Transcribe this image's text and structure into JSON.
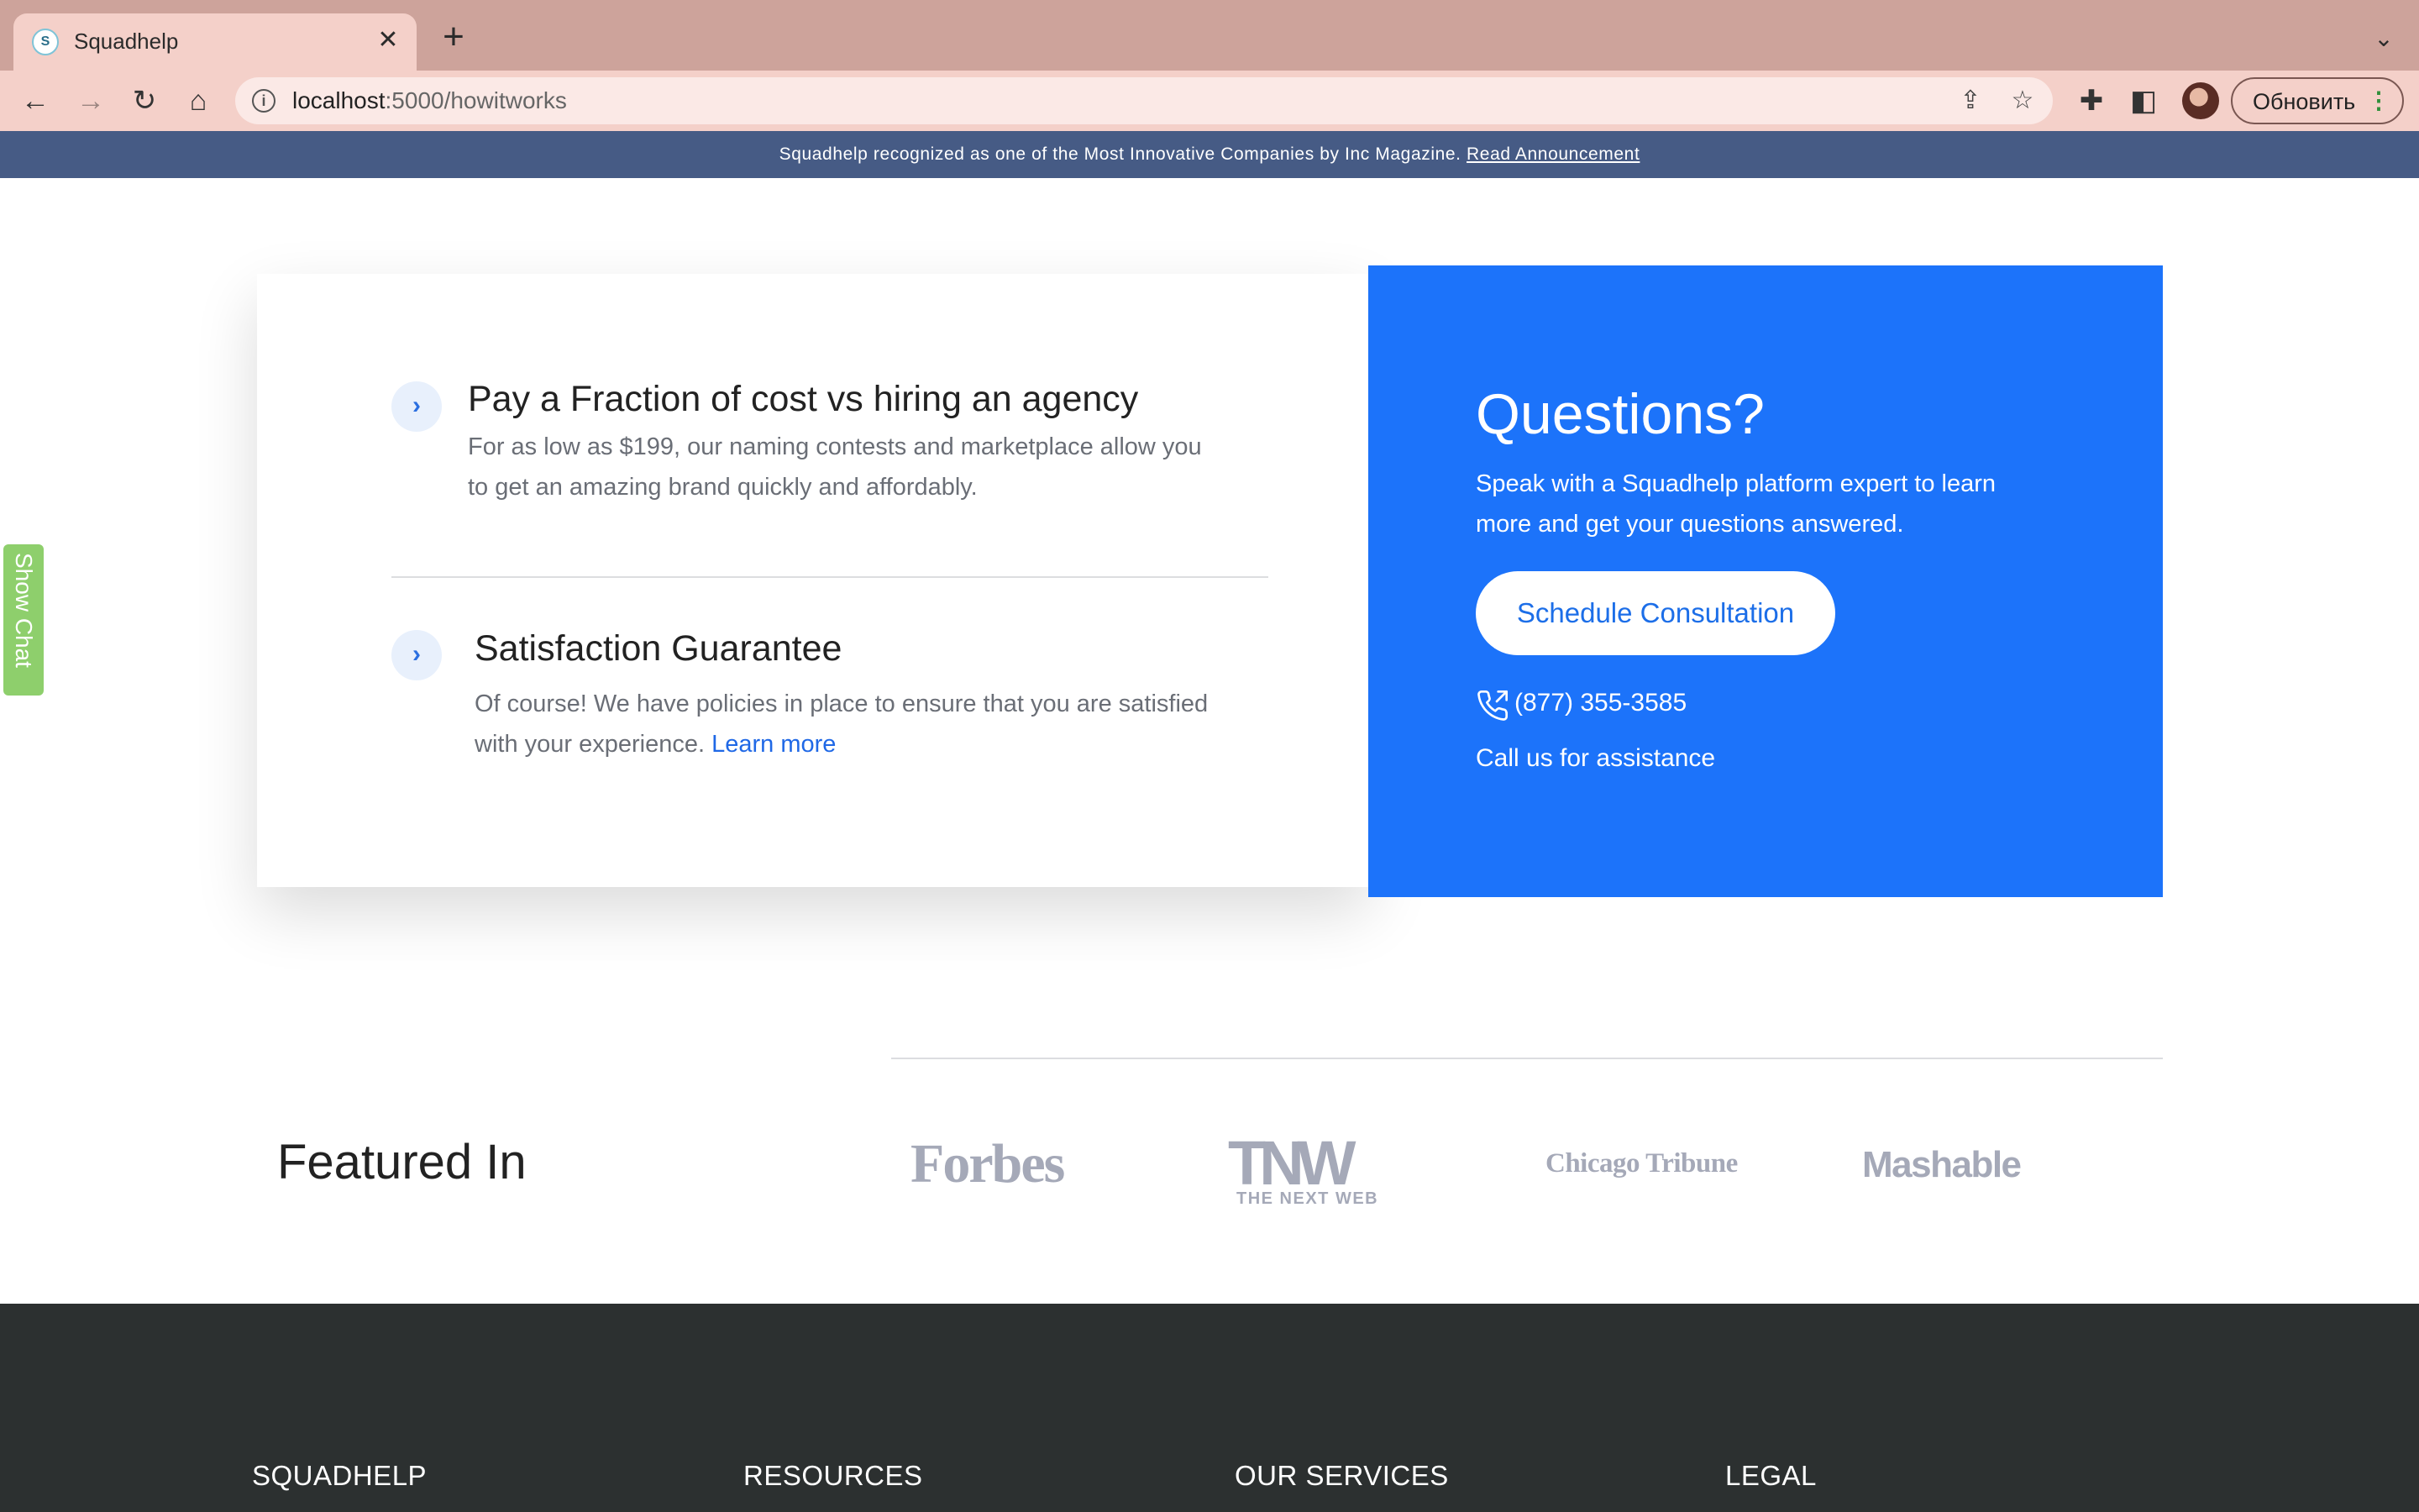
{
  "browser": {
    "tab_title": "Squadhelp",
    "tab_favicon_letter": "S",
    "tab_close_glyph": "✕",
    "new_tab_glyph": "+",
    "tab_list_glyph": "⌄",
    "back_glyph": "←",
    "forward_glyph": "→",
    "reload_glyph": "↻",
    "home_glyph": "⌂",
    "info_glyph": "i",
    "url_host": "localhost",
    "url_rest": ":5000/howitworks",
    "share_glyph": "⇪",
    "star_glyph": "☆",
    "extensions_glyph": "✚",
    "sidepanel_glyph": "◧",
    "update_label": "Обновить",
    "menu_glyph": "⋮"
  },
  "announcement": {
    "text": "Squadhelp recognized as one of the Most Innovative Companies by Inc Magazine.",
    "link": "Read Announcement"
  },
  "benefits": [
    {
      "icon": "chevron-right-icon",
      "title": "Pay a Fraction of cost vs hiring an agency",
      "description": "For as low as $199, our naming contests and marketplace allow you to get an amazing brand quickly and affordably."
    },
    {
      "icon": "chevron-right-icon",
      "title": "Satisfaction Guarantee",
      "description": "Of course! We have policies in place to ensure that you are satisfied with your experience.",
      "link": "Learn more"
    }
  ],
  "questions": {
    "title": "Questions?",
    "description": "Speak with a Squadhelp platform expert to learn more and get your questions answered.",
    "button": "Schedule Consultation",
    "phone": "(877) 355-3585",
    "call_text": "Call us for assistance"
  },
  "chat_widget": {
    "label": "Show Chat"
  },
  "featured": {
    "title": "Featured In",
    "logos": {
      "forbes": "Forbes",
      "tnw_big": "TNW",
      "tnw_small": "THE NEXT WEB",
      "chicago": "Chicago Tribune",
      "mashable": "Mashable"
    }
  },
  "footer": {
    "columns": [
      "SQUADHELP",
      "RESOURCES",
      "OUR SERVICES",
      "LEGAL"
    ]
  },
  "colors": {
    "tab_strip": "#cda39b",
    "toolbar": "#f4d0c9",
    "announcement_bg": "#465b85",
    "accent_blue": "#1c73fa",
    "link_blue": "#1f68e6",
    "footer_bg": "#2c3030",
    "chat_green": "#8ecf6c",
    "logo_gray": "#a5a9b8"
  }
}
